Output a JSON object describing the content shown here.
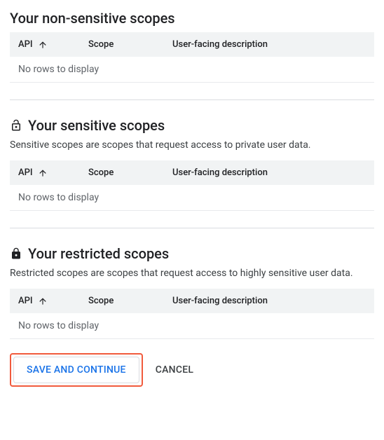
{
  "sections": {
    "non_sensitive": {
      "title": "Your non-sensitive scopes",
      "headers": {
        "api": "API",
        "scope": "Scope",
        "desc": "User-facing description"
      },
      "empty": "No rows to display"
    },
    "sensitive": {
      "title": "Your sensitive scopes",
      "description": "Sensitive scopes are scopes that request access to private user data.",
      "headers": {
        "api": "API",
        "scope": "Scope",
        "desc": "User-facing description"
      },
      "empty": "No rows to display"
    },
    "restricted": {
      "title": "Your restricted scopes",
      "description": "Restricted scopes are scopes that request access to highly sensitive user data.",
      "headers": {
        "api": "API",
        "scope": "Scope",
        "desc": "User-facing description"
      },
      "empty": "No rows to display"
    }
  },
  "buttons": {
    "save": "Save and Continue",
    "cancel": "Cancel"
  },
  "icons": {
    "lock_open": "lock-open-icon",
    "lock_closed": "lock-closed-icon",
    "sort_arrow": "arrow-upward-icon"
  }
}
